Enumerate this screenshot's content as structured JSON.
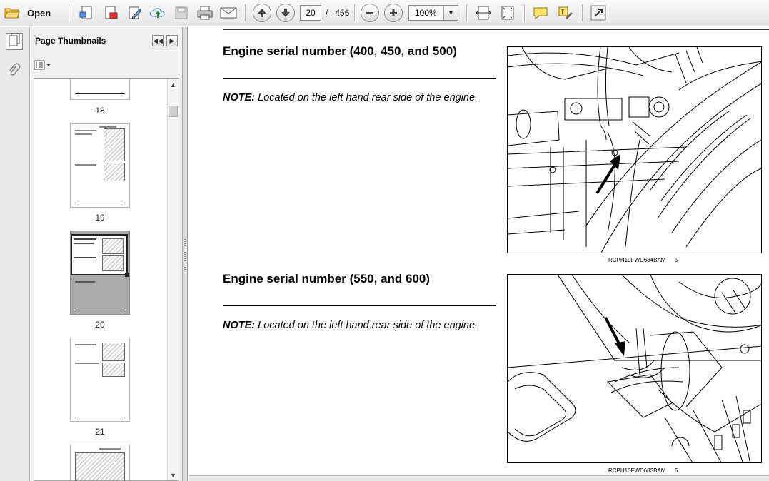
{
  "toolbar": {
    "open_label": "Open",
    "current_page": "20",
    "page_separator": "/",
    "total_pages": "456",
    "zoom": "100%"
  },
  "panel": {
    "title": "Page Thumbnails"
  },
  "thumbnails": [
    {
      "page": "18"
    },
    {
      "page": "19"
    },
    {
      "page": "20",
      "selected": true
    },
    {
      "page": "21"
    }
  ],
  "document": {
    "sections": [
      {
        "heading": "Engine serial number (400, 450, and 500)",
        "note_label": "NOTE:",
        "note_text": " Located on the left hand rear side of the engine.",
        "figure_code": "RCPH10FWD684BAM",
        "figure_number": "5"
      },
      {
        "heading": "Engine serial number (550, and 600)",
        "note_label": "NOTE:",
        "note_text": " Located on the left hand rear side of the engine.",
        "figure_code": "RCPH10FWD683BAM",
        "figure_number": "6"
      }
    ]
  },
  "colors": {
    "toolbar_bg": "#e6e6e6",
    "panel_bg": "#f0f0f0",
    "thumb_selected": "#a9a9a9"
  }
}
